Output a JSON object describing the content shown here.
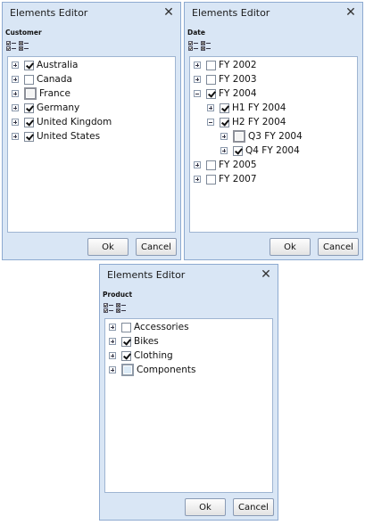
{
  "dialogs": [
    {
      "title": "Elements Editor",
      "section_label": "Customer",
      "tools": [
        "check-all-icon",
        "uncheck-all-icon"
      ],
      "ok_label": "Ok",
      "cancel_label": "Cancel",
      "items": [
        {
          "label": "Australia",
          "state": "checked",
          "expander": "plus"
        },
        {
          "label": "Canada",
          "state": "unchecked",
          "expander": "plus"
        },
        {
          "label": "France",
          "state": "partial",
          "expander": "plus"
        },
        {
          "label": "Germany",
          "state": "checked",
          "expander": "plus"
        },
        {
          "label": "United Kingdom",
          "state": "checked",
          "expander": "plus"
        },
        {
          "label": "United States",
          "state": "checked",
          "expander": "plus"
        }
      ]
    },
    {
      "title": "Elements Editor",
      "section_label": "Date",
      "tools": [
        "check-all-icon",
        "uncheck-all-icon"
      ],
      "ok_label": "Ok",
      "cancel_label": "Cancel",
      "items": [
        {
          "label": "FY 2002",
          "state": "unchecked",
          "expander": "plus",
          "level": 0
        },
        {
          "label": "FY 2003",
          "state": "unchecked",
          "expander": "plus",
          "level": 0
        },
        {
          "label": "FY 2004",
          "state": "checked",
          "expander": "minus",
          "level": 0
        },
        {
          "label": "H1 FY 2004",
          "state": "checked",
          "expander": "plus",
          "level": 1
        },
        {
          "label": "H2 FY 2004",
          "state": "checked",
          "expander": "minus",
          "level": 1
        },
        {
          "label": "Q3 FY 2004",
          "state": "partial",
          "expander": "plus",
          "level": 2
        },
        {
          "label": "Q4 FY 2004",
          "state": "checked",
          "expander": "plus",
          "level": 2
        },
        {
          "label": "FY 2005",
          "state": "unchecked",
          "expander": "plus",
          "level": 0
        },
        {
          "label": "FY 2007",
          "state": "unchecked",
          "expander": "plus",
          "level": 0
        }
      ]
    },
    {
      "title": "Elements Editor",
      "section_label": "Product",
      "tools": [
        "check-all-icon",
        "uncheck-all-icon"
      ],
      "ok_label": "Ok",
      "cancel_label": "Cancel",
      "items": [
        {
          "label": "Accessories",
          "state": "unchecked",
          "expander": "plus"
        },
        {
          "label": "Bikes",
          "state": "checked",
          "expander": "plus"
        },
        {
          "label": "Clothing",
          "state": "checked",
          "expander": "plus"
        },
        {
          "label": "Components",
          "state": "partial-blue",
          "expander": "plus"
        }
      ]
    }
  ],
  "colors": {
    "dialog_bg": "#d9e6f5",
    "dialog_border": "#8eaad0",
    "tree_bg": "#ffffff"
  }
}
